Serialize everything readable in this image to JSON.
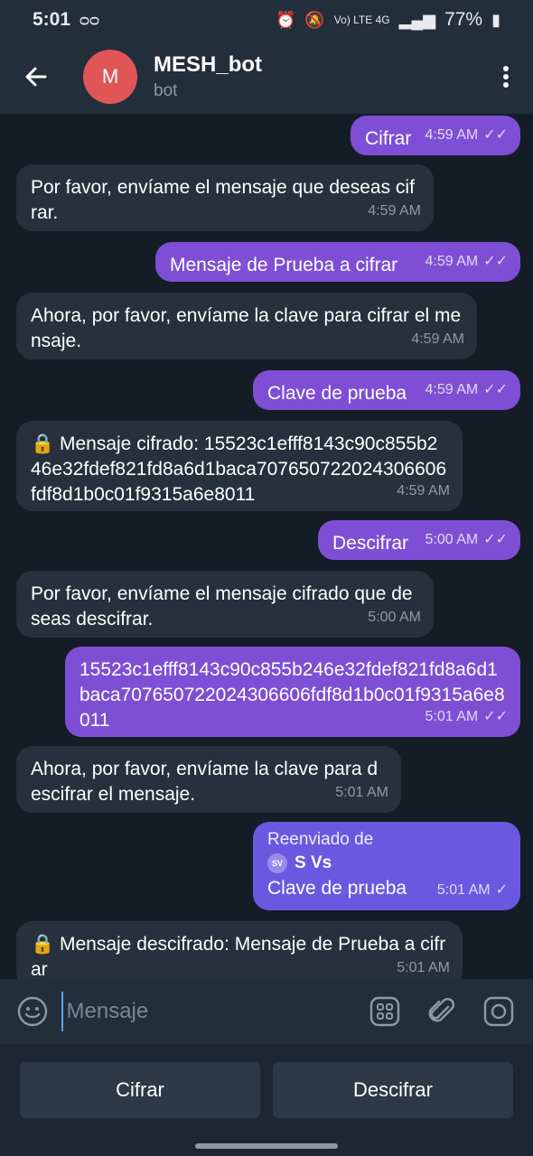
{
  "status_bar": {
    "time": "5:01",
    "voicemail_icon": "voicemail-icon",
    "battery": "77%",
    "network": "Vo) LTE 4G"
  },
  "header": {
    "avatar_letter": "M",
    "title": "MESH_bot",
    "subtitle": "bot"
  },
  "messages": [
    {
      "dir": "out",
      "text": "Cifrar",
      "time": "4:59 AM",
      "status": "read"
    },
    {
      "dir": "in",
      "text": "Por favor, envíame el mensaje que deseas cifrar.",
      "time": "4:59 AM"
    },
    {
      "dir": "out",
      "text": "Mensaje de Prueba a cifrar",
      "time": "4:59 AM",
      "status": "read"
    },
    {
      "dir": "in",
      "text": "Ahora, por favor, envíame la clave para cifrar el mensaje.",
      "time": "4:59 AM"
    },
    {
      "dir": "out",
      "text": "Clave de prueba",
      "time": "4:59 AM",
      "status": "read"
    },
    {
      "dir": "in",
      "text": "🔒 Mensaje cifrado: 15523c1efff8143c90c855b246e32fdef821fd8a6d1baca707650722024306606fdf8d1b0c01f9315a6e8011",
      "time": "4:59 AM"
    },
    {
      "dir": "out",
      "text": "Descifrar",
      "time": "5:00 AM",
      "status": "read"
    },
    {
      "dir": "in",
      "text": "Por favor, envíame el mensaje cifrado que deseas descifrar.",
      "time": "5:00 AM"
    },
    {
      "dir": "out",
      "text": "15523c1efff8143c90c855b246e32fdef821fd8a6d1baca707650722024306606fdf8d1b0c01f9315a6e8011",
      "time": "5:01 AM",
      "status": "read"
    },
    {
      "dir": "in",
      "text": "Ahora, por favor, envíame la clave para descifrar el mensaje.",
      "time": "5:01 AM"
    },
    {
      "dir": "fwd",
      "label": "Reenviado de",
      "from_initials": "SV",
      "from_name": "S Vs",
      "text": "Clave de prueba",
      "time": "5:01 AM",
      "status": "sent"
    },
    {
      "dir": "in",
      "text": "🔒 Mensaje descifrado: Mensaje de Prueba a cifrar",
      "time": "5:01 AM"
    }
  ],
  "input": {
    "placeholder": "Mensaje"
  },
  "keyboard": {
    "buttons": [
      "Cifrar",
      "Descifrar"
    ]
  },
  "colors": {
    "outgoing_bubble": "#7e4fd4",
    "incoming_bubble": "#26313d",
    "header": "#222e3a",
    "chat_bg": "#141d26"
  }
}
